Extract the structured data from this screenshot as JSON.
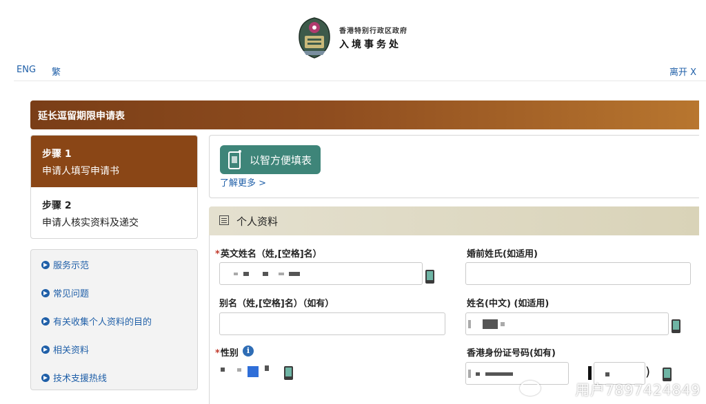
{
  "header": {
    "dept_line1": "香港特别行政区政府",
    "dept_line2": "入境事务处",
    "lang_eng": "ENG",
    "lang_trad": "繁",
    "leave": "离开 X"
  },
  "form_title": "延长逗留期限申请表",
  "steps": [
    {
      "number": "步骤 1",
      "desc": "申请人填写申请书",
      "active": true
    },
    {
      "number": "步骤 2",
      "desc": "申请人核实资料及递交",
      "active": false
    }
  ],
  "links": [
    "服务示范",
    "常见问题",
    "有关收集个人资料的目的",
    "相关资料",
    "技术支援热线"
  ],
  "smart": {
    "button": "以智方便填表",
    "learn_more": "了解更多 >"
  },
  "personal": {
    "section_title": "个人资料",
    "required_mark": "*",
    "english_name_label": "英文姓名（姓,[空格]名）",
    "maiden_name_label": "婚前姓氏(如适用)",
    "alias_label": "别名（姓,[空格]名）（如有）",
    "chinese_name_label": "姓名(中文) (如适用)",
    "sex_label": "性别",
    "hkid_label": "香港身份证号码(如有)",
    "hkid_close_paren": ")"
  },
  "watermark": "用户7897424849",
  "colors": {
    "title_bar": "#8a4616",
    "smart_button": "#3e8579",
    "link": "#1f5fa8"
  }
}
